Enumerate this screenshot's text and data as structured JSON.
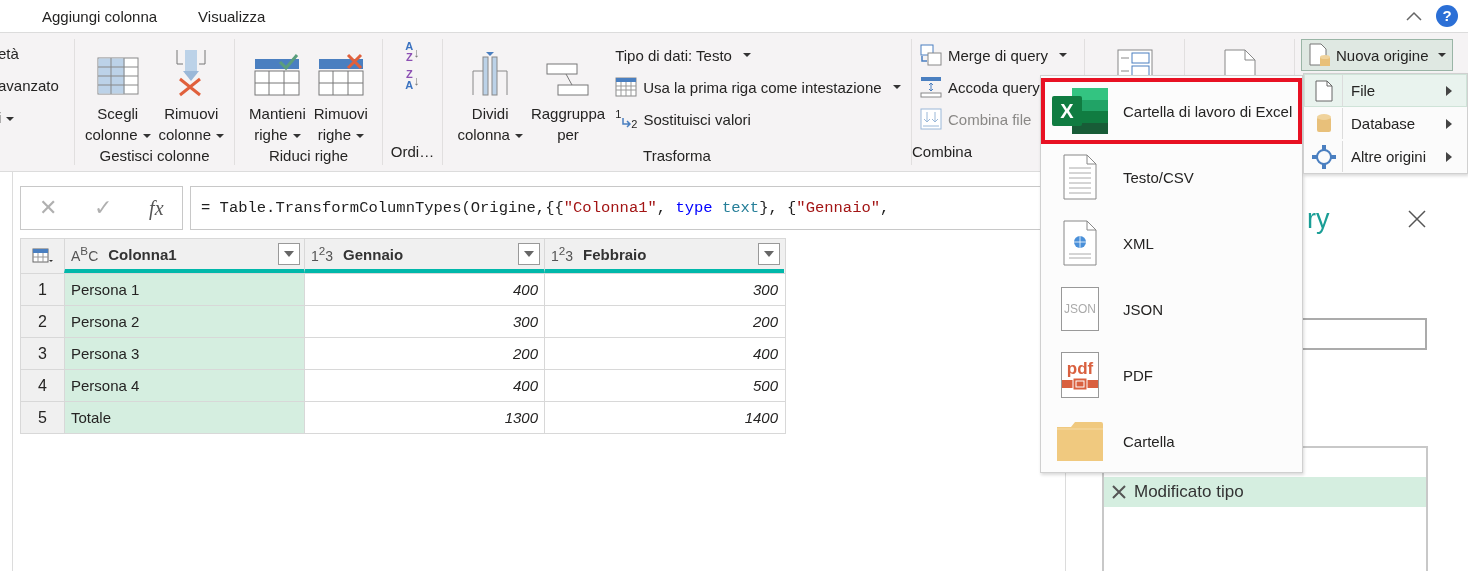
{
  "tabs": [
    {
      "label": "Aggiungi colonna",
      "selected": false
    },
    {
      "label": "Visualizza",
      "selected": false
    }
  ],
  "help_button": "?",
  "ribbon": {
    "partial_group": {
      "items": [
        {
          "label": "età",
          "dropdown": false
        },
        {
          "label": "avanzato",
          "dropdown": false
        },
        {
          "label": "i",
          "dropdown": true
        }
      ]
    },
    "groups": [
      {
        "label": "Gestisci colonne",
        "buttons": [
          {
            "kind": "choose-columns",
            "lines": [
              "Scegli",
              "colonne"
            ],
            "dropdown": true
          },
          {
            "kind": "remove-columns",
            "lines": [
              "Rimuovi",
              "colonne"
            ],
            "dropdown": true
          }
        ]
      },
      {
        "label": "Riduci righe",
        "buttons": [
          {
            "kind": "keep-rows",
            "lines": [
              "Mantieni",
              "righe"
            ],
            "dropdown": true
          },
          {
            "kind": "remove-rows",
            "lines": [
              "Rimuovi",
              "righe"
            ],
            "dropdown": true
          }
        ]
      },
      {
        "label": "Ordi…",
        "sort_buttons": [
          {
            "top": "A",
            "bottom": "Z",
            "arrow": "↓"
          },
          {
            "top": "Z",
            "bottom": "A",
            "arrow": "↓"
          }
        ]
      },
      {
        "label": "Trasforma",
        "buttons": [
          {
            "kind": "split-column",
            "lines": [
              "Dividi",
              "colonna"
            ],
            "dropdown": true
          },
          {
            "kind": "group-by",
            "lines": [
              "Raggruppa",
              "per"
            ],
            "dropdown": false
          }
        ],
        "small_buttons": [
          {
            "kind": "plain",
            "label": "Tipo di dati: Testo",
            "dropdown": true,
            "disabled": false
          },
          {
            "kind": "table",
            "label": "Usa la prima riga come intestazione",
            "dropdown": true,
            "disabled": false
          },
          {
            "kind": "replace",
            "icon_text": [
              "1",
              "2"
            ],
            "label": "Sostituisci valori",
            "dropdown": false,
            "disabled": false
          }
        ]
      },
      {
        "label": "Combina",
        "small_buttons": [
          {
            "kind": "merge",
            "label": "Merge di query",
            "dropdown": true,
            "disabled": false
          },
          {
            "kind": "append",
            "label": "Accoda query",
            "dropdown": false,
            "disabled": false
          },
          {
            "kind": "combine-files",
            "label": "Combina file",
            "dropdown": false,
            "disabled": true
          }
        ]
      },
      {
        "kind": "parameters"
      },
      {
        "kind": "document-source"
      },
      {
        "kind": "new-source",
        "dropdown_button": {
          "label": "Nuova origine",
          "pressed": true
        }
      }
    ]
  },
  "formula_bar": {
    "cancel": "✕",
    "confirm": "✓",
    "fx": "fx",
    "segments": [
      {
        "kind": "plain",
        "text": "= Table.TransformColumnTypes(Origine,{{"
      },
      {
        "kind": "string",
        "text": "\"Colonna1\""
      },
      {
        "kind": "plain",
        "text": ", "
      },
      {
        "kind": "keyword",
        "text": "type"
      },
      {
        "kind": "type",
        "text": " text"
      },
      {
        "kind": "plain",
        "text": "}, {"
      },
      {
        "kind": "string",
        "text": "\"Gennaio\""
      },
      {
        "kind": "plain",
        "text": ","
      }
    ]
  },
  "table": {
    "columns": [
      {
        "type_icon": "A$^{B}$C",
        "name": "Colonna1",
        "kind": "text",
        "selected": true
      },
      {
        "type_icon": "1$^{2}$3",
        "name": "Gennaio",
        "kind": "number",
        "selected": false
      },
      {
        "type_icon": "1$^{2}$3",
        "name": "Febbraio",
        "kind": "number",
        "selected": false
      }
    ],
    "rows": [
      {
        "index": "1",
        "cells": [
          "Persona 1",
          "400",
          "300"
        ]
      },
      {
        "index": "2",
        "cells": [
          "Persona 2",
          "300",
          "200"
        ]
      },
      {
        "index": "3",
        "cells": [
          "Persona 3",
          "200",
          "400"
        ]
      },
      {
        "index": "4",
        "cells": [
          "Persona 4",
          "400",
          "500"
        ]
      },
      {
        "index": "5",
        "cells": [
          "Totale",
          "1300",
          "1400"
        ]
      }
    ]
  },
  "query_panel": {
    "title": "ry",
    "steps": [
      {
        "label": "Modificato tipo",
        "selected": true
      }
    ]
  },
  "source_menu": {
    "items": [
      {
        "kind": "file",
        "label": "File",
        "selected": true
      },
      {
        "kind": "database",
        "label": "Database",
        "selected": false
      },
      {
        "kind": "other",
        "label": "Altre origini",
        "selected": false
      }
    ]
  },
  "file_menu": {
    "items": [
      {
        "kind": "excel",
        "icon_text": "X",
        "label": "Cartella di lavoro di Excel",
        "highlighted": true
      },
      {
        "kind": "text",
        "label": "Testo/CSV",
        "highlighted": false
      },
      {
        "kind": "xml",
        "label": "XML",
        "highlighted": false
      },
      {
        "kind": "json",
        "icon_text": "JSON",
        "label": "JSON",
        "highlighted": false
      },
      {
        "kind": "pdf",
        "icon_text": "pdf",
        "label": "PDF",
        "highlighted": false
      },
      {
        "kind": "folder",
        "label": "Cartella",
        "highlighted": false
      }
    ]
  }
}
